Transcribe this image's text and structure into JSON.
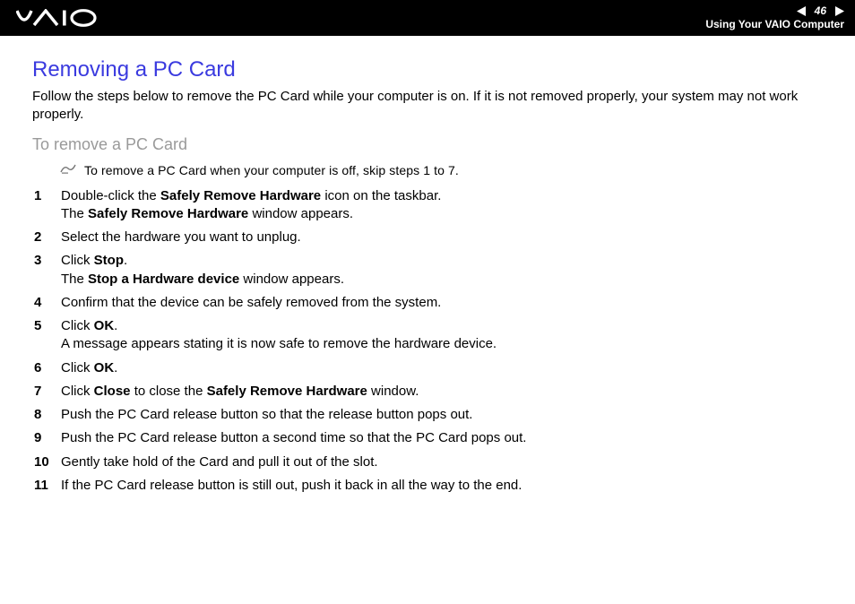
{
  "header": {
    "page_number": "46",
    "section": "Using Your VAIO Computer"
  },
  "title": "Removing a PC Card",
  "intro": "Follow the steps below to remove the PC Card while your computer is on. If it is not removed properly, your system may not work properly.",
  "subheading": "To remove a PC Card",
  "note": "To remove a PC Card when your computer is off, skip steps 1 to 7.",
  "steps": {
    "s1a": "Double-click the ",
    "s1b": "Safely Remove Hardware",
    "s1c": " icon on the taskbar.",
    "s1d": "The ",
    "s1e": "Safely Remove Hardware",
    "s1f": " window appears.",
    "s2": "Select the hardware you want to unplug.",
    "s3a": "Click ",
    "s3b": "Stop",
    "s3c": ".",
    "s3d": "The ",
    "s3e": "Stop a Hardware device",
    "s3f": " window appears.",
    "s4": "Confirm that the device can be safely removed from the system.",
    "s5a": "Click ",
    "s5b": "OK",
    "s5c": ".",
    "s5d": "A message appears stating it is now safe to remove the hardware device.",
    "s6a": "Click ",
    "s6b": "OK",
    "s6c": ".",
    "s7a": "Click ",
    "s7b": "Close",
    "s7c": " to close the ",
    "s7d": "Safely Remove Hardware",
    "s7e": " window.",
    "s8": "Push the PC Card release button so that the release button pops out.",
    "s9": "Push the PC Card release button a second time so that the PC Card pops out.",
    "s10": "Gently take hold of the Card and pull it out of the slot.",
    "s11": "If the PC Card release button is still out, push it back in all the way to the end."
  }
}
